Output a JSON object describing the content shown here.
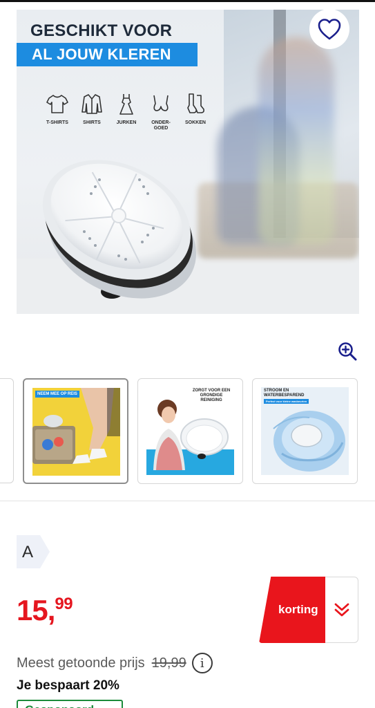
{
  "product_image": {
    "headline_line1": "GESCHIKT VOOR",
    "headline_line2": "AL JOUW KLEREN",
    "clothing": [
      {
        "label": "T-SHIRTS",
        "icon": "tshirt-icon"
      },
      {
        "label": "SHIRTS",
        "icon": "shirt-icon"
      },
      {
        "label": "JURKEN",
        "icon": "dress-icon"
      },
      {
        "label": "ONDER-\nGOED",
        "icon": "underwear-icon"
      },
      {
        "label": "SOKKEN",
        "icon": "socks-icon"
      }
    ]
  },
  "favorite_icon": "heart-icon",
  "zoom_icon": "zoom-in-icon",
  "thumbnails": [
    {
      "caption": "NEEM MEE OP REIS"
    },
    {
      "caption": "ZORGT VOOR EEN\nGRONDIGE REINIGING"
    },
    {
      "caption": "STROOM EN\nWATERBESPAREND",
      "subcaption": "Perfect voor kleine wasbeurten"
    }
  ],
  "energy_label": "A",
  "price": {
    "whole": "15,",
    "cents": "99"
  },
  "discount": {
    "label": "korting",
    "icon": "double-chevron-down-icon"
  },
  "most_shown_price": {
    "label": "Meest getoonde prijs",
    "value": "19,99",
    "icon": "info-icon"
  },
  "savings": "Je bespaart 20%",
  "bottom_badge": "Gesponsord"
}
